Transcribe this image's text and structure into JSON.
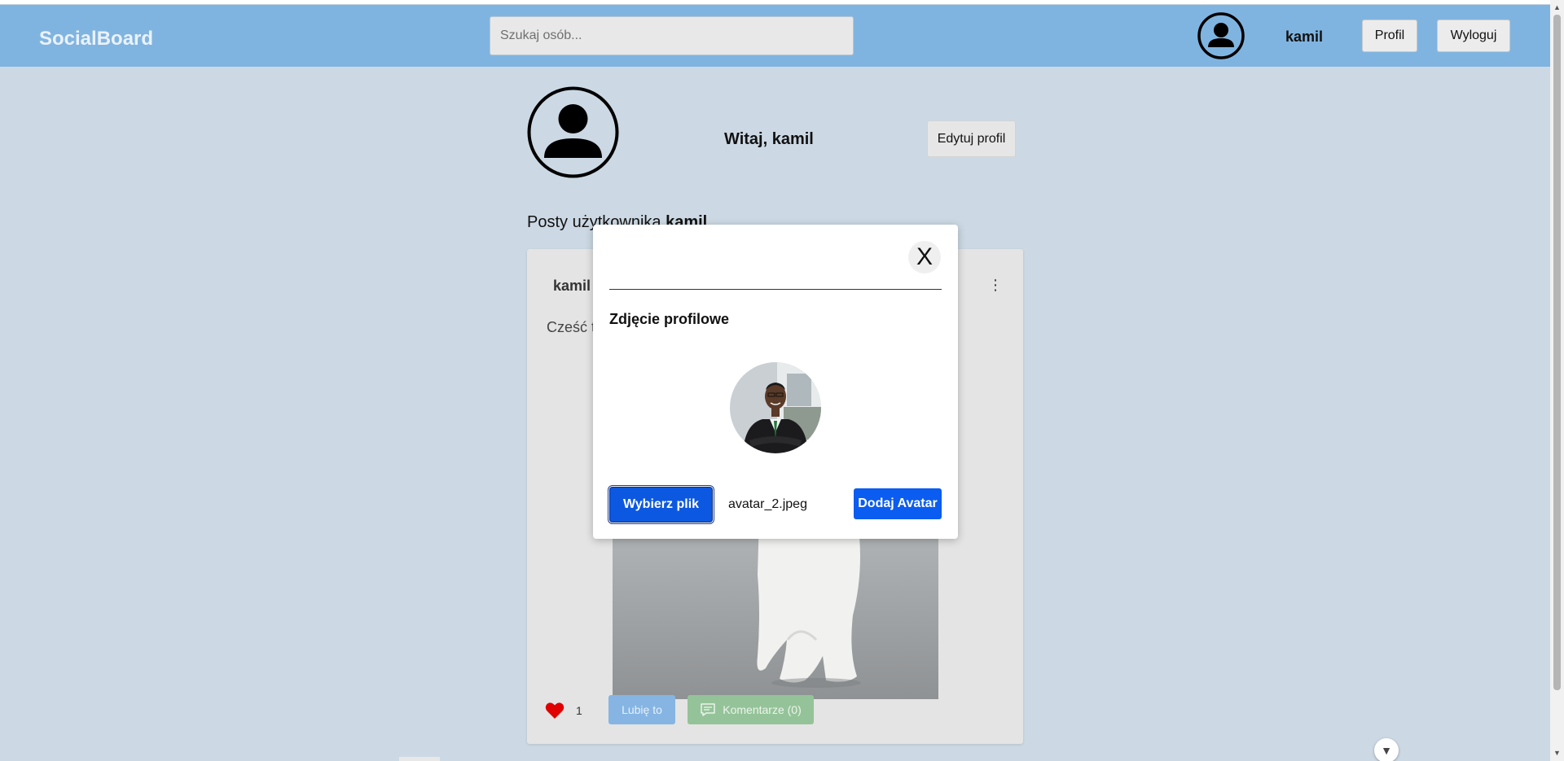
{
  "app": {
    "brand": "SocialBoard"
  },
  "navbar": {
    "search_placeholder": "Szukaj osób...",
    "username": "kamil",
    "profile_label": "Profil",
    "logout_label": "Wyloguj"
  },
  "profile": {
    "welcome": "Witaj, kamil",
    "edit_label": "Edytuj profil",
    "posts_heading_prefix": "Posty użytkownika",
    "posts_heading_user": "kamil"
  },
  "post": {
    "author": "kamil",
    "text": "Cześć t",
    "like_count": "1",
    "like_label": "Lubię to",
    "comments_label": "Komentarze (0)"
  },
  "modal": {
    "close_label": "X",
    "title": "Zdjęcie profilowe",
    "choose_file_label": "Wybierz plik",
    "file_name": "avatar_2.jpeg",
    "add_avatar_label": "Dodaj Avatar"
  },
  "icons": {
    "nav_avatar": "user-circle-icon",
    "profile_avatar": "user-circle-icon",
    "post_menu": "vertical-dots-icon",
    "heart": "heart-icon",
    "comment": "comment-icon",
    "scroll_down": "chevron-down-icon"
  },
  "colors": {
    "navbar": "#80b4e0",
    "background": "#ccd9e4",
    "primary_button": "#0b5cf0",
    "like_button": "#86b5e3",
    "comments_button": "#95c399",
    "heart": "#e00000"
  }
}
